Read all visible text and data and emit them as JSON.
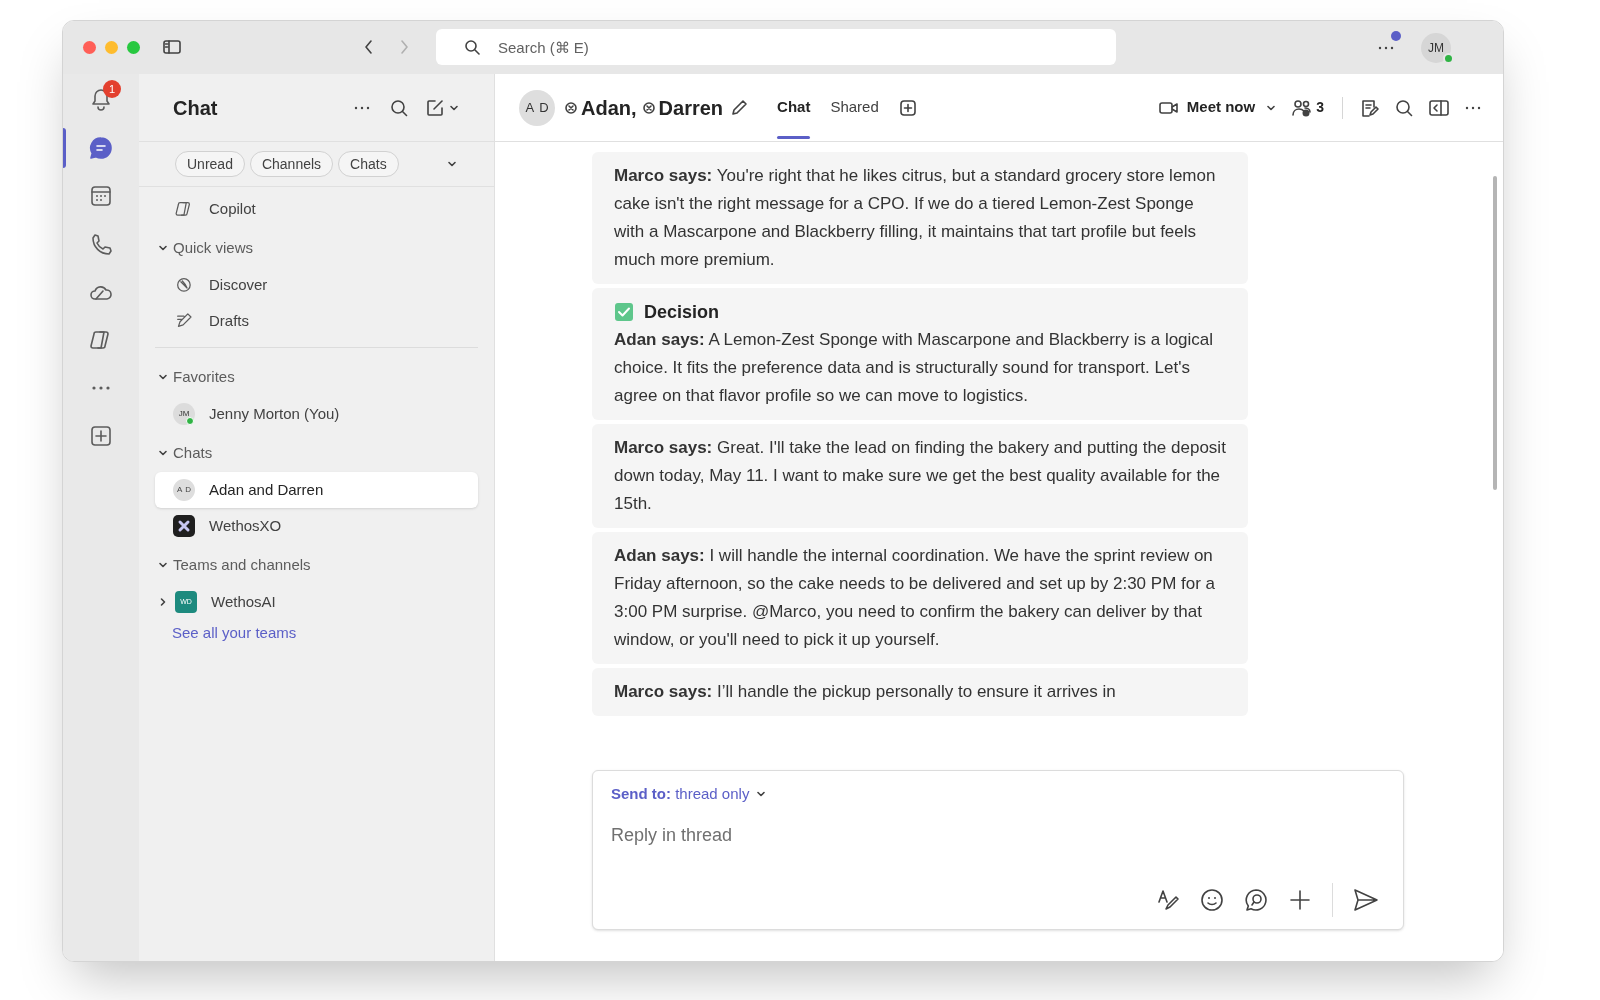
{
  "title_bar": {
    "search_placeholder": "Search (⌘ E)",
    "profile_initials": "JM"
  },
  "rail": [
    {
      "kind": "activity",
      "badge": "1",
      "selected": false
    },
    {
      "kind": "chat",
      "selected": true
    },
    {
      "kind": "calendar",
      "selected": false
    },
    {
      "kind": "calls",
      "selected": false
    },
    {
      "kind": "cloud",
      "selected": false
    },
    {
      "kind": "copilot",
      "selected": false
    },
    {
      "kind": "more",
      "selected": false
    },
    {
      "kind": "apps",
      "selected": false
    }
  ],
  "sidebar": {
    "title": "Chat",
    "filters": [
      "Unread",
      "Channels",
      "Chats"
    ],
    "top_items": [
      {
        "kind": "copilot",
        "label": "Copilot"
      }
    ],
    "sections": [
      {
        "label": "Quick views",
        "expanded": true,
        "divider_after": true,
        "items": [
          {
            "kind": "discover",
            "label": "Discover",
            "selected": false
          },
          {
            "kind": "drafts",
            "label": "Drafts",
            "selected": false
          }
        ]
      },
      {
        "label": "Favorites",
        "expanded": true,
        "items": [
          {
            "kind": "person",
            "initials": "JM",
            "online": true,
            "label": "Jenny Morton (You)",
            "selected": false
          }
        ]
      },
      {
        "label": "Chats",
        "expanded": true,
        "items": [
          {
            "kind": "group",
            "initials": [
              "A",
              "D"
            ],
            "label": "Adan and Darren",
            "selected": true
          },
          {
            "kind": "app",
            "label": "WethosXO",
            "selected": false
          }
        ]
      },
      {
        "label": "Teams and channels",
        "expanded": true,
        "items": [
          {
            "kind": "team",
            "initials": "WD",
            "label": "WethosAI",
            "expanded": false,
            "selected": false
          }
        ]
      }
    ],
    "link": "See all your teams"
  },
  "chat_header": {
    "initials": [
      "A",
      "D"
    ],
    "names": [
      "Adan,",
      "Darren"
    ],
    "tabs": [
      {
        "label": "Chat",
        "selected": true
      },
      {
        "label": "Shared",
        "selected": false
      }
    ],
    "meet_now": "Meet now",
    "participants": "3"
  },
  "messages": [
    {
      "kind": "message",
      "text": "**Marco says:** You're right that he likes citrus, but a standard grocery store lemon cake isn't the right message for a CPO. If we do a tiered Lemon-Zest Sponge with a Mascarpone and Blackberry filling, it maintains that tart profile but feels much more premium."
    },
    {
      "kind": "decision",
      "heading": "Decision",
      "text": "**Adan says:** A Lemon-Zest Sponge with Mascarpone and Blackberry is a logical choice. It fits the preference data and is structurally sound for transport. Let's agree on that flavor profile so we can move to logistics."
    },
    {
      "kind": "message",
      "text": "**Marco says:** Great. I'll take the lead on finding the bakery and putting the deposit down today, May 11. I want to make sure we get the best quality available for the 15th."
    },
    {
      "kind": "message",
      "text": "**Adan says:** I will handle the internal coordination. We have the sprint review on Friday afternoon, so the cake needs to be delivered and set up by 2:30 PM for a 3:00 PM surprise. @Marco, you need to confirm the bakery can deliver by that window, or you'll need to pick it up yourself."
    },
    {
      "kind": "message",
      "text": "**Marco says:** I’ll handle the pickup personally to ensure it arrives in"
    }
  ],
  "composer": {
    "send_to": "**Send to:** thread only",
    "placeholder": "Reply in thread"
  }
}
